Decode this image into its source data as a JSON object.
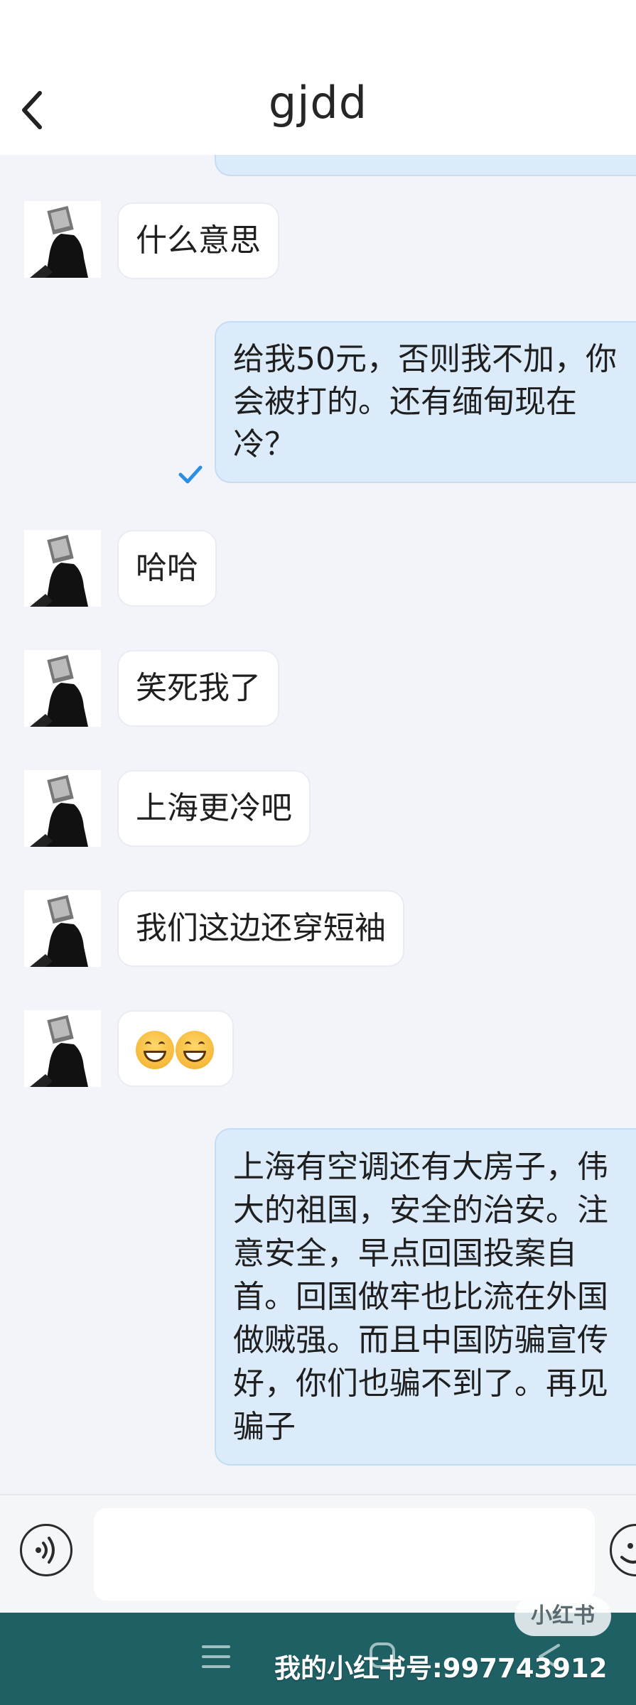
{
  "header": {
    "title": "gjdd",
    "back_icon": "chevron-left-icon"
  },
  "messages": [
    {
      "side": "in",
      "text": "什么意思"
    },
    {
      "side": "out",
      "text": "给我50元，否则我不加，你会被打的。还有缅甸现在冷？",
      "status": "read"
    },
    {
      "side": "in",
      "text": "哈哈"
    },
    {
      "side": "in",
      "text": "笑死我了"
    },
    {
      "side": "in",
      "text": "上海更冷吧"
    },
    {
      "side": "in",
      "text": "我们这边还穿短袖"
    },
    {
      "side": "in",
      "emoji": [
        "grinning-face-emoji",
        "grinning-face-emoji"
      ]
    },
    {
      "side": "out",
      "text": "上海有空调还有大房子，伟大的祖国，安全的治安。注意安全，早点回国投案自首。回国做牢也比流在外国做贼强。而且中国防骗宣传好，你们也骗不到了。再见骗子"
    }
  ],
  "input_bar": {
    "voice_icon": "voice-input-icon",
    "input_value": "",
    "emoji_icon": "emoji-smile-icon"
  },
  "nav": {
    "menu_icon": "menu-icon",
    "home_icon": "home-icon",
    "back_icon": "back-icon"
  },
  "watermark": {
    "logo_text": "小红书",
    "text": "我的小红书号:997743912"
  },
  "colors": {
    "outgoing_bubble": "#dbebfa",
    "incoming_bubble": "#ffffff",
    "chat_background": "#f2f4fa",
    "nav_background": "#1f6064",
    "check_color": "#2a8fe3"
  }
}
